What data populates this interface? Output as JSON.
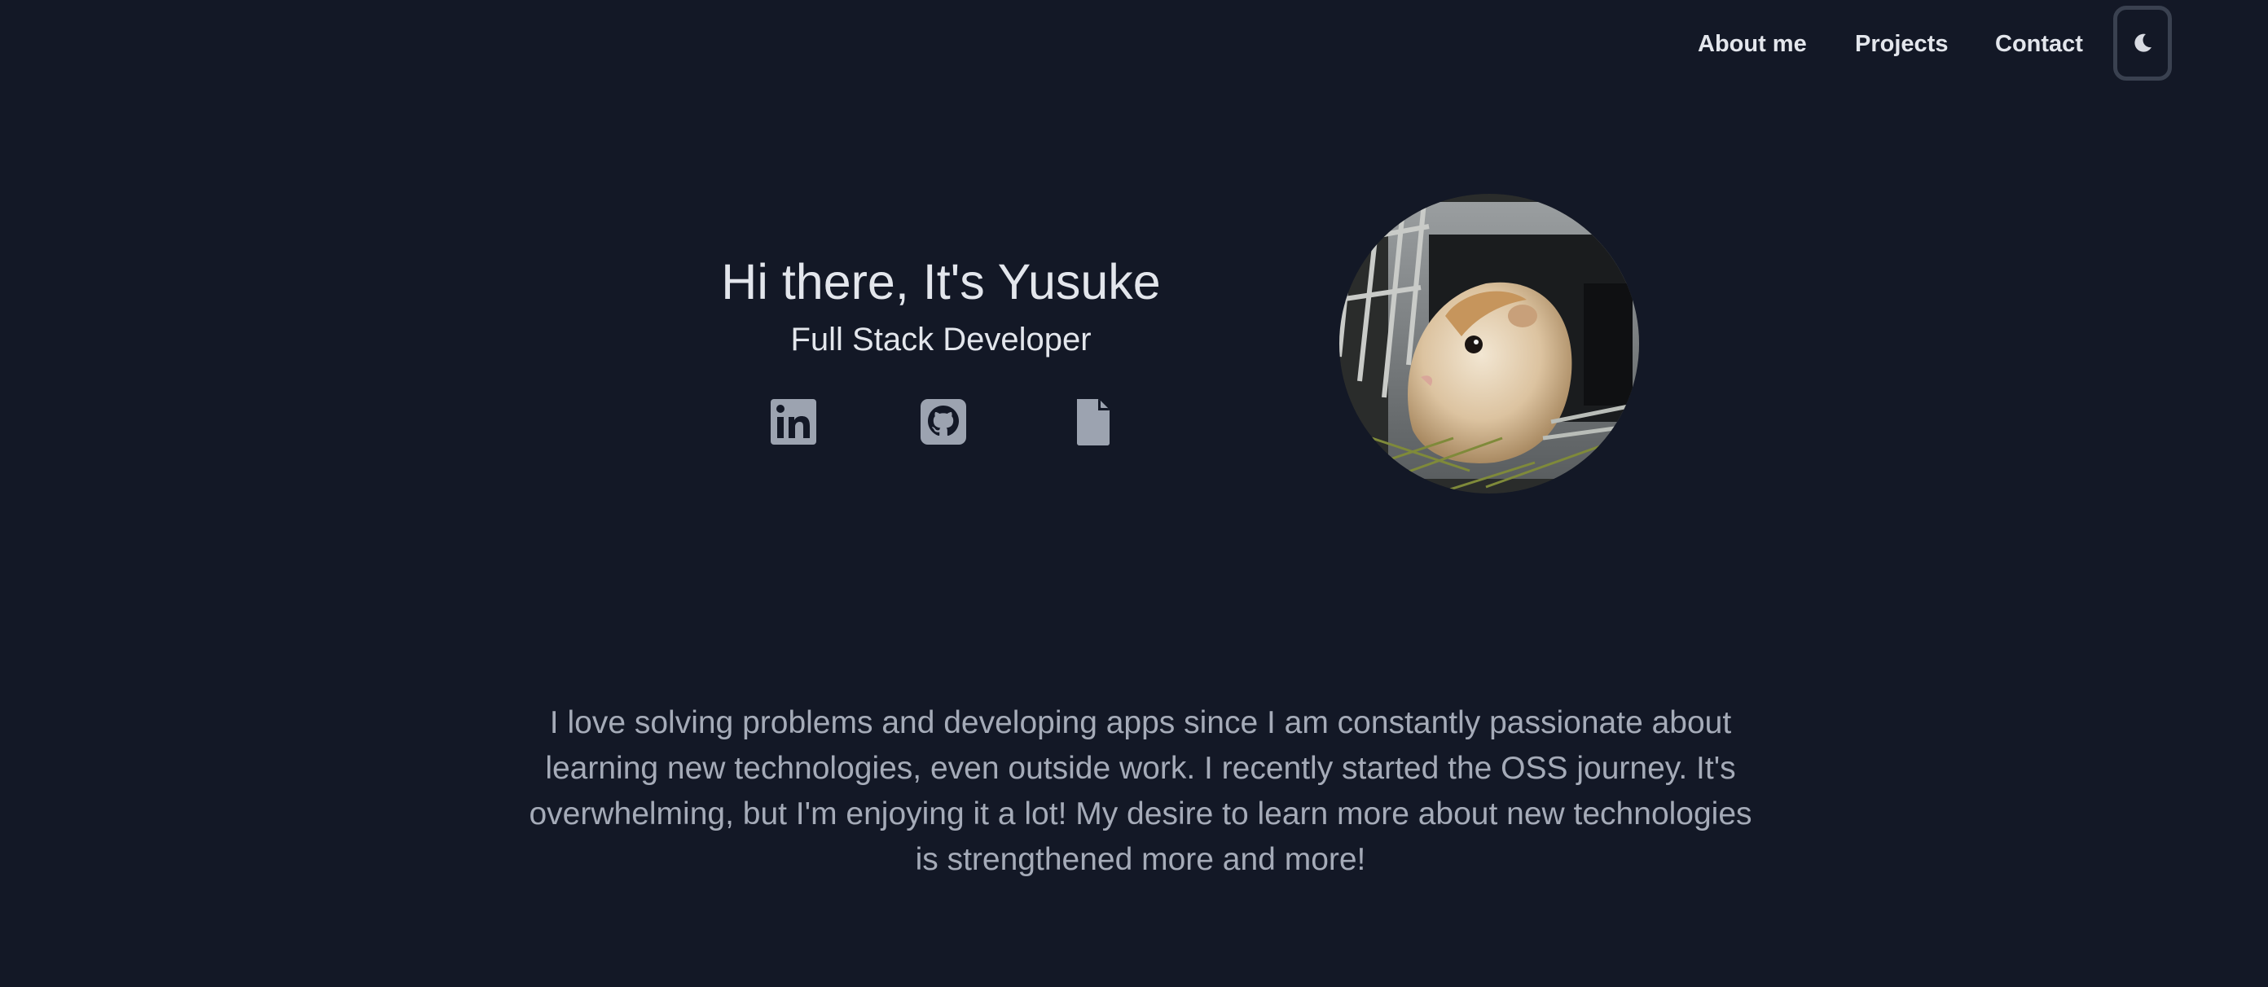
{
  "nav": {
    "items": [
      {
        "label": "About me"
      },
      {
        "label": "Projects"
      },
      {
        "label": "Contact"
      }
    ],
    "theme_toggle_icon": "moon-icon"
  },
  "hero": {
    "title": "Hi there, It's Yusuke",
    "subtitle": "Full Stack Developer",
    "social_icons": [
      "linkedin-icon",
      "github-icon",
      "document-icon"
    ],
    "avatar_image": "guinea-pig-photo"
  },
  "about": {
    "text": "I love solving problems and developing apps since I am constantly passionate about learning new technologies, even outside work. I recently started the OSS journey. It's overwhelming, but I'm enjoying it a lot! My desire to learn more about new technologies is strengthened more and more!"
  },
  "colors": {
    "background": "#131826",
    "primary_text": "#e3e6ec",
    "secondary_text": "#a5abb8",
    "icon": "#9ca3b0",
    "toggle_border": "#3a4150"
  }
}
